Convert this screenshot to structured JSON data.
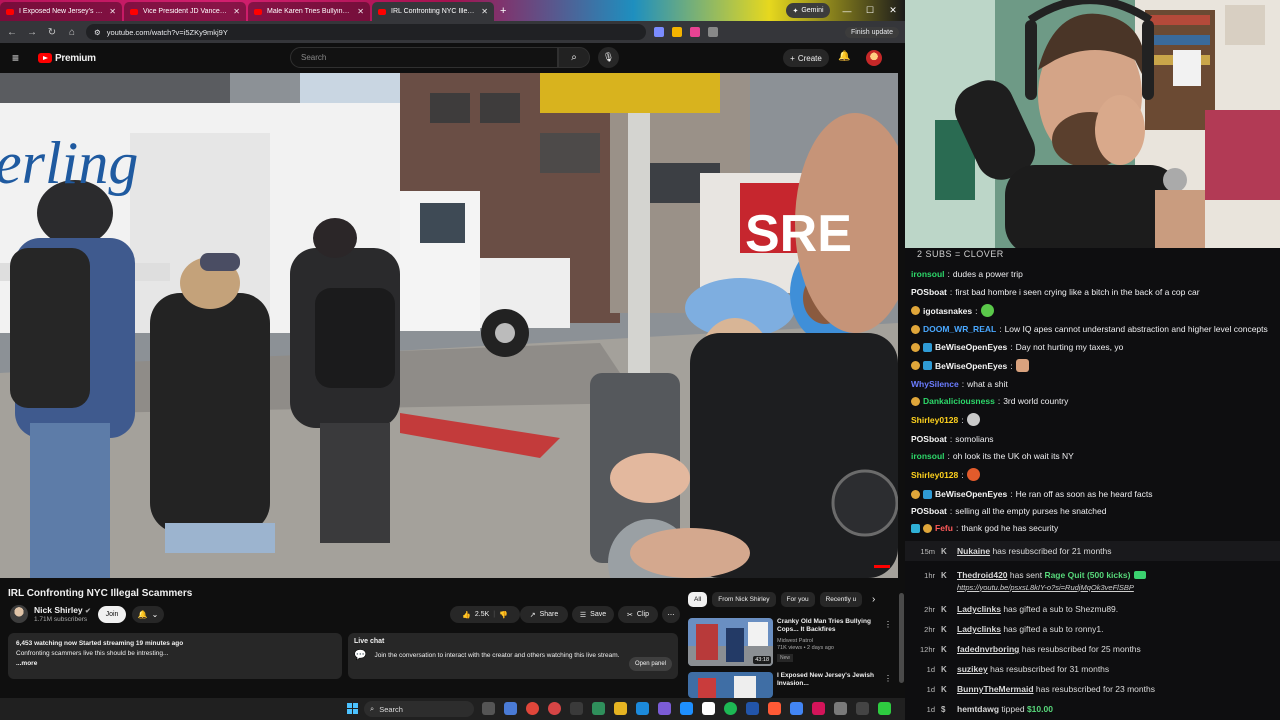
{
  "browser": {
    "tabs": [
      {
        "label": "I Exposed New Jersey's Jewish",
        "active": false
      },
      {
        "label": "Vice President JD Vance Delive",
        "active": false
      },
      {
        "label": "Male Karen Tries Bullying Offic",
        "active": false
      },
      {
        "label": "IRL Confronting NYC Illegal",
        "active": true
      }
    ],
    "gemini_label": "Gemini",
    "url": "youtube.com/watch?v=i5ZKy9mkj9Y",
    "finish_update_label": "Finish update"
  },
  "youtube": {
    "logo_text": "Premium",
    "search_placeholder": "Search",
    "create_label": "Create",
    "video": {
      "title": "IRL Confronting NYC Illegal Scammers",
      "channel": "Nick Shirley",
      "subscribers": "1.71M subscribers",
      "join_label": "Join",
      "likes": "2.5K",
      "share_label": "Share",
      "save_label": "Save",
      "clip_label": "Clip",
      "description_meta": "6,453 watching now  Started streaming 19 minutes ago",
      "description_text": "Confronting scammers live this should be intresting...",
      "more_label": "...more"
    },
    "live_chat": {
      "heading": "Live chat",
      "text": "Join the conversation to interact with the creator and others watching this live stream.",
      "open_panel_label": "Open panel"
    },
    "chips": [
      "All",
      "From Nick Shirley",
      "For you",
      "Recently u"
    ],
    "recommendations": [
      {
        "title": "Cranky Old Man Tries Bullying Cops... It Backfires",
        "channel": "Midwest Patrol",
        "meta": "71K views • 2 days ago",
        "badge": "New",
        "duration": "43:18"
      },
      {
        "title": "I Exposed New Jersey's Jewish Invasion...",
        "channel": "",
        "meta": "",
        "badge": "",
        "duration": ""
      }
    ]
  },
  "taskbar": {
    "search_label": "Search"
  },
  "chat": {
    "header": "2 SUBS = CLOVER",
    "messages": [
      {
        "user": "ironsoul",
        "color": "#2dd86a",
        "text": "dudes a power trip",
        "badges": [],
        "emote": ""
      },
      {
        "user": "POSboat",
        "color": "#f5f5f5",
        "text": "first bad hombre i seen crying like a bitch in the back of a cop car",
        "badges": [],
        "emote": ""
      },
      {
        "user": "igotasnakes",
        "color": "#f5f5f5",
        "text": "",
        "badges": [
          "gold"
        ],
        "emote": "green"
      },
      {
        "user": "DOOM_WR_REAL",
        "color": "#4aa8ff",
        "text": "Low IQ apes cannot understand abstraction and higher level concepts",
        "badges": [
          "gold"
        ],
        "emote": ""
      },
      {
        "user": "BeWiseOpenEyes",
        "color": "#f5f5f5",
        "text": "Day not hurting my taxes, yo",
        "badges": [
          "gold",
          "blue"
        ],
        "emote": ""
      },
      {
        "user": "BeWiseOpenEyes",
        "color": "#f5f5f5",
        "text": "",
        "badges": [
          "gold",
          "blue"
        ],
        "emote": "face"
      },
      {
        "user": "WhySilence",
        "color": "#6a7cff",
        "text": "what a shit",
        "badges": [],
        "emote": ""
      },
      {
        "user": "Dankaliciousness",
        "color": "#2dd86a",
        "text": "3rd world country",
        "badges": [
          "gold"
        ],
        "emote": ""
      },
      {
        "user": "Shirley0128",
        "color": "#ffd21e",
        "text": "",
        "badges": [],
        "emote": "glasses"
      },
      {
        "user": "POSboat",
        "color": "#f5f5f5",
        "text": "somolians",
        "badges": [],
        "emote": ""
      },
      {
        "user": "ironsoul",
        "color": "#2dd86a",
        "text": "oh look its the UK oh wait its NY",
        "badges": [],
        "emote": ""
      },
      {
        "user": "Shirley0128",
        "color": "#ffd21e",
        "text": "",
        "badges": [],
        "emote": "angry"
      },
      {
        "user": "BeWiseOpenEyes",
        "color": "#f5f5f5",
        "text": "He ran off as soon as he heard facts",
        "badges": [
          "gold",
          "blue"
        ],
        "emote": ""
      },
      {
        "user": "POSboat",
        "color": "#f5f5f5",
        "text": "selling all the empty purses he snatched",
        "badges": [],
        "emote": ""
      },
      {
        "user": "Fefu",
        "color": "#ff5a5a",
        "text": "thank god he has security",
        "badges": [
          "teal",
          "gold"
        ],
        "emote": ""
      }
    ],
    "events": [
      {
        "time": "15m",
        "name": "Nukaine",
        "text": "has resubscribed for 21 months",
        "extra": "",
        "link": ""
      },
      {
        "time": "1hr",
        "name": "Thedroid420",
        "text": "has sent",
        "extra": "Rage Quit (500 kicks)",
        "link": "https://youtu.be/psxsL8kIY-o?si=RudjMqOk3veFlSBP"
      },
      {
        "time": "2hr",
        "name": "Ladyclinks",
        "text": "has gifted a sub to Shezmu89.",
        "extra": "",
        "link": ""
      },
      {
        "time": "2hr",
        "name": "Ladyclinks",
        "text": "has gifted a sub to ronny1.",
        "extra": "",
        "link": ""
      },
      {
        "time": "12hr",
        "name": "fadednvrboring",
        "text": "has resubscribed for 25 months",
        "extra": "",
        "link": ""
      },
      {
        "time": "1d",
        "name": "suzikey",
        "text": "has resubscribed for 31 months",
        "extra": "",
        "link": ""
      },
      {
        "time": "1d",
        "name": "BunnyTheMermaid",
        "text": "has resubscribed for 23 months",
        "extra": "",
        "link": ""
      },
      {
        "time": "1d",
        "name": "hemtdawg",
        "text": "tipped",
        "extra": "$10.00",
        "link": ""
      }
    ]
  }
}
